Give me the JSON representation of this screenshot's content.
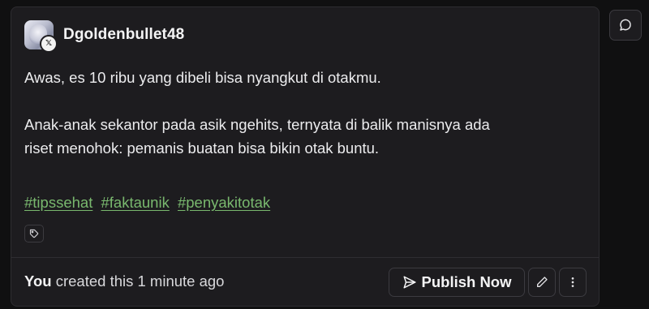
{
  "post": {
    "username": "Dgoldenbullet48",
    "platform_badge": "𝕏",
    "paragraph1": "Awas, es 10 ribu yang dibeli bisa nyangkut di otakmu.",
    "paragraph2_line1": "Anak-anak sekantor pada asik ngehits, ternyata di balik manisnya ada",
    "paragraph2_line2": "riset menohok: pemanis buatan bisa bikin otak buntu.",
    "hashtags": [
      "#tipssehat",
      "#faktaunik",
      "#penyakitotak"
    ]
  },
  "footer": {
    "actor": "You",
    "status": " created this 1 minute ago",
    "publish_label": "Publish Now"
  },
  "icons": {
    "avatar": "user-avatar",
    "tag": "tag-icon",
    "send": "send-icon",
    "edit": "pencil-icon",
    "more": "more-vertical-icon",
    "comment": "comment-icon"
  },
  "colors": {
    "background": "#101011",
    "card": "#1d1c1f",
    "hashtag": "#79b86e",
    "text": "#ececee"
  }
}
